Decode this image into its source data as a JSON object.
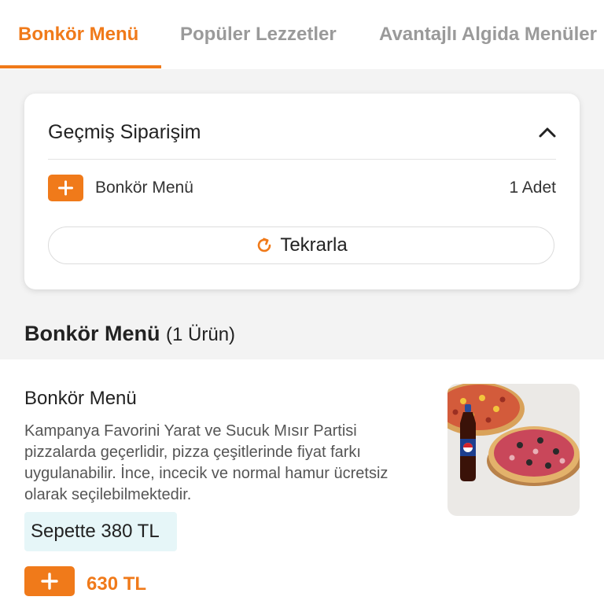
{
  "tabs": [
    {
      "label": "Bonkör Menü"
    },
    {
      "label": "Popüler Lezzetler"
    },
    {
      "label": "Avantajlı Algida Menüler"
    }
  ],
  "history": {
    "title": "Geçmiş Siparişim",
    "item_name": "Bonkör Menü",
    "item_qty": "1 Adet",
    "repeat_label": "Tekrarla"
  },
  "section": {
    "title": "Bonkör Menü",
    "count": "(1 Ürün)"
  },
  "product": {
    "name": "Bonkör Menü",
    "description": "Kampanya Favorini Yarat ve Sucuk Mısır Partisi pizzalarda geçerlidir, pizza çeşitlerinde fiyat farkı uygulanabilir. İnce, incecik ve normal hamur ücretsiz olarak seçilebilmektedir.",
    "cart_price": "Sepette 380 TL",
    "price": "630 TL"
  },
  "colors": {
    "accent": "#f07a1a",
    "badge_bg": "#e6f6f8",
    "inactive_tab": "#9a9a9a"
  },
  "icons": {
    "collapse": "chevron-up-icon",
    "add": "plus-icon",
    "repeat": "refresh-icon"
  }
}
